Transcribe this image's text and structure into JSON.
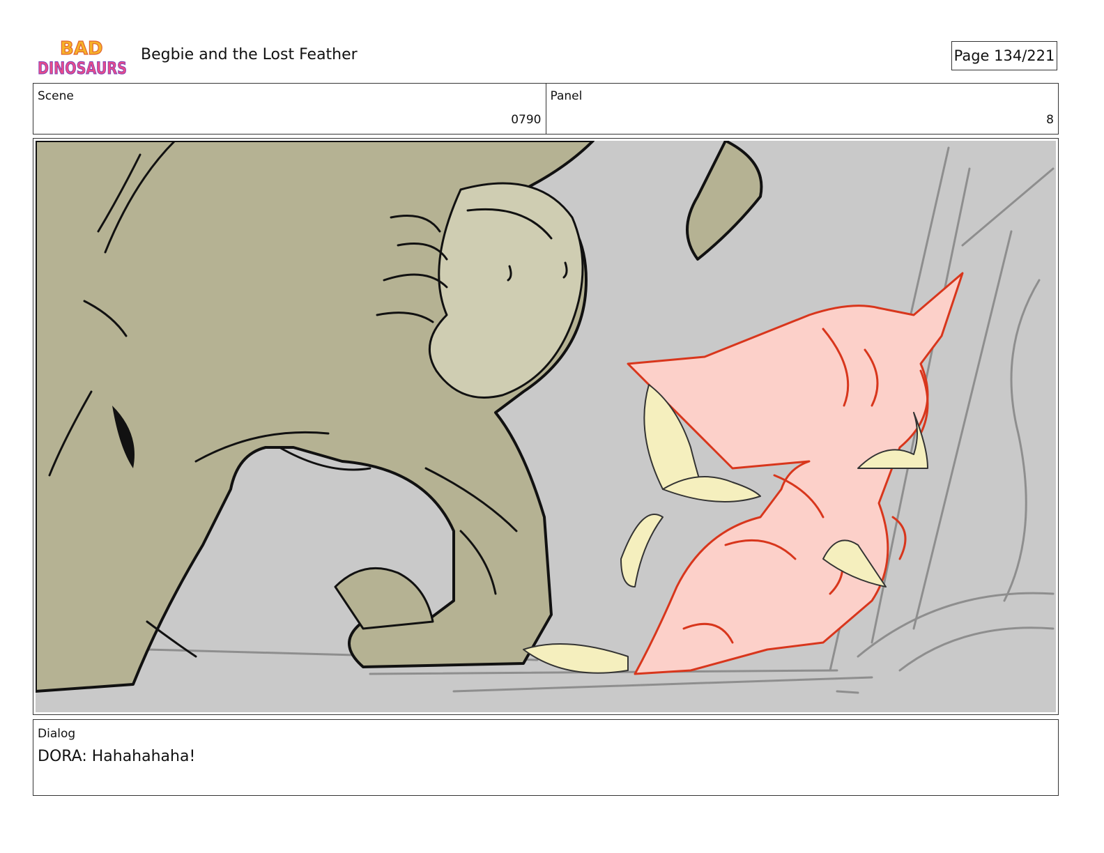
{
  "header": {
    "logo_text": "BAD DINOSAURS",
    "title": "Begbie and the Lost Feather",
    "page_label": "Page 134/221"
  },
  "scene": {
    "label": "Scene",
    "value": "0790"
  },
  "panel": {
    "label": "Panel",
    "value": "8"
  },
  "dialog": {
    "label": "Dialog",
    "text": "DORA: Hahahahaha!"
  },
  "colors": {
    "background": "#c9c9c9",
    "dino_green": "#b5b293",
    "dino_light": "#cfcdb2",
    "pink": "#fcd0c9",
    "red_line": "#d8361c",
    "feather": "#f5efbe"
  }
}
